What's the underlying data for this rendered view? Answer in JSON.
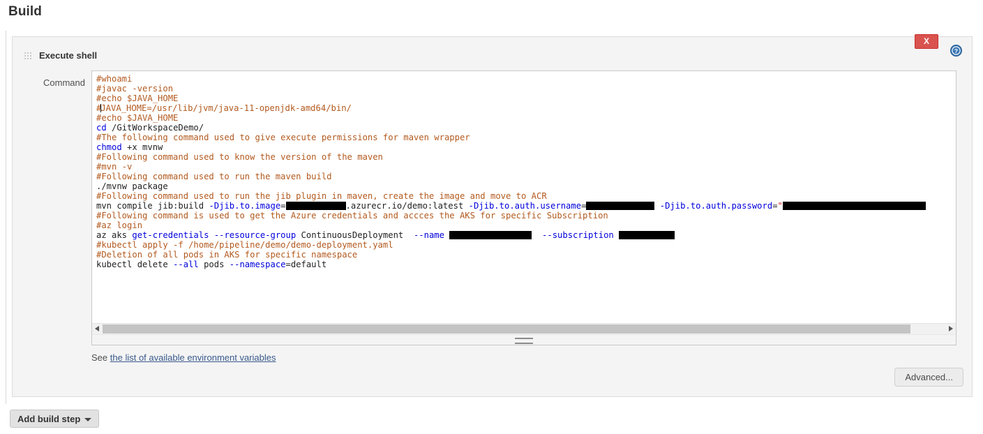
{
  "page": {
    "title": "Build"
  },
  "build_step": {
    "title": "Execute shell",
    "grip_icon": "drag-handle-icon",
    "delete_label": "X",
    "help_icon": "help-circle-icon",
    "command_label": "Command",
    "help_text_prefix": "See",
    "help_link_text": "the list of available environment variables",
    "advanced_label": "Advanced...",
    "scrollbar": {
      "left_arrow_icon": "arrow-left-icon",
      "right_arrow_icon": "arrow-right-icon",
      "thumb_fraction": 0.93
    },
    "resize_grip_icon": "resize-handle-icon"
  },
  "toolbar": {
    "add_build_step_label": "Add build step",
    "add_build_step_caret_icon": "chevron-down-icon"
  },
  "colors": {
    "accent_delete": "#d9534f",
    "comment": "#b35a1f",
    "keyword": "#0000dd",
    "link": "#3a5a8c",
    "panel_bg": "#f4f4f4",
    "redaction": "#000000"
  },
  "command": {
    "lines": [
      [
        {
          "t": "#whoami",
          "c": "comment"
        }
      ],
      [
        {
          "t": "#javac -version",
          "c": "comment"
        }
      ],
      [
        {
          "t": "#echo $JAVA_HOME",
          "c": "comment"
        }
      ],
      [
        {
          "t": "#",
          "c": "comment"
        },
        {
          "caret": true
        },
        {
          "t": "JAVA_HOME=/usr/lib/jvm/java-11-openjdk-amd64/bin/",
          "c": "comment"
        }
      ],
      [
        {
          "t": "#echo $JAVA_HOME",
          "c": "comment"
        }
      ],
      [
        {
          "t": "cd",
          "c": "keyword"
        },
        {
          "t": " /GitWorkspaceDemo/",
          "c": "plain"
        }
      ],
      [
        {
          "t": "#The following command used to give execute permissions for maven wrapper",
          "c": "comment"
        }
      ],
      [
        {
          "t": "chmod",
          "c": "keyword"
        },
        {
          "t": " +x mvnw",
          "c": "plain"
        }
      ],
      [
        {
          "t": "#Following command used to know the version of the maven",
          "c": "comment"
        }
      ],
      [
        {
          "t": "#mvn -v",
          "c": "comment"
        }
      ],
      [
        {
          "t": "#Following command used to run the maven build",
          "c": "comment"
        }
      ],
      [
        {
          "t": "./mvnw package",
          "c": "plain"
        }
      ],
      [
        {
          "t": "#Following command used to run the jib plugin in maven, create the image and move to ACR",
          "c": "comment"
        }
      ],
      [
        {
          "t": "mvn compile jib:build ",
          "c": "plain"
        },
        {
          "t": "-Djib.to.image",
          "c": "keyword"
        },
        {
          "t": "=",
          "c": "plain"
        },
        {
          "redact": 86
        },
        {
          "t": ".azurecr.io/demo:latest ",
          "c": "plain"
        },
        {
          "t": "-Djib.to.auth.username",
          "c": "keyword"
        },
        {
          "t": "=",
          "c": "plain"
        },
        {
          "redact": 98
        },
        {
          "t": " ",
          "c": "plain"
        },
        {
          "t": "-Djib.to.auth.password",
          "c": "keyword"
        },
        {
          "t": "=",
          "c": "plain"
        },
        {
          "t": "\"",
          "c": "string"
        },
        {
          "redact": 205
        }
      ],
      [
        {
          "t": "#Following command is used to get the Azure credentials and accces the AKS for specific Subscription",
          "c": "comment"
        }
      ],
      [
        {
          "t": "#az login",
          "c": "comment"
        }
      ],
      [
        {
          "t": "az aks ",
          "c": "plain"
        },
        {
          "t": "get-credentials",
          "c": "keyword"
        },
        {
          "t": " ",
          "c": "plain"
        },
        {
          "t": "--resource-group",
          "c": "keyword"
        },
        {
          "t": " ContinuousDeployment  ",
          "c": "plain"
        },
        {
          "t": "--name",
          "c": "keyword"
        },
        {
          "t": " ",
          "c": "plain"
        },
        {
          "redact": 118
        },
        {
          "t": "  ",
          "c": "plain"
        },
        {
          "t": "--subscription",
          "c": "keyword"
        },
        {
          "t": " ",
          "c": "plain"
        },
        {
          "redact": 80
        }
      ],
      [
        {
          "t": "#kubectl apply -f /home/pipeline/demo/demo-deployment.yaml",
          "c": "comment"
        }
      ],
      [
        {
          "t": "#Deletion of all pods in AKS for specific namespace",
          "c": "comment"
        }
      ],
      [
        {
          "t": "kubectl delete ",
          "c": "plain"
        },
        {
          "t": "--all",
          "c": "keyword"
        },
        {
          "t": " pods ",
          "c": "plain"
        },
        {
          "t": "--namespace",
          "c": "keyword"
        },
        {
          "t": "=default",
          "c": "plain"
        }
      ]
    ]
  }
}
